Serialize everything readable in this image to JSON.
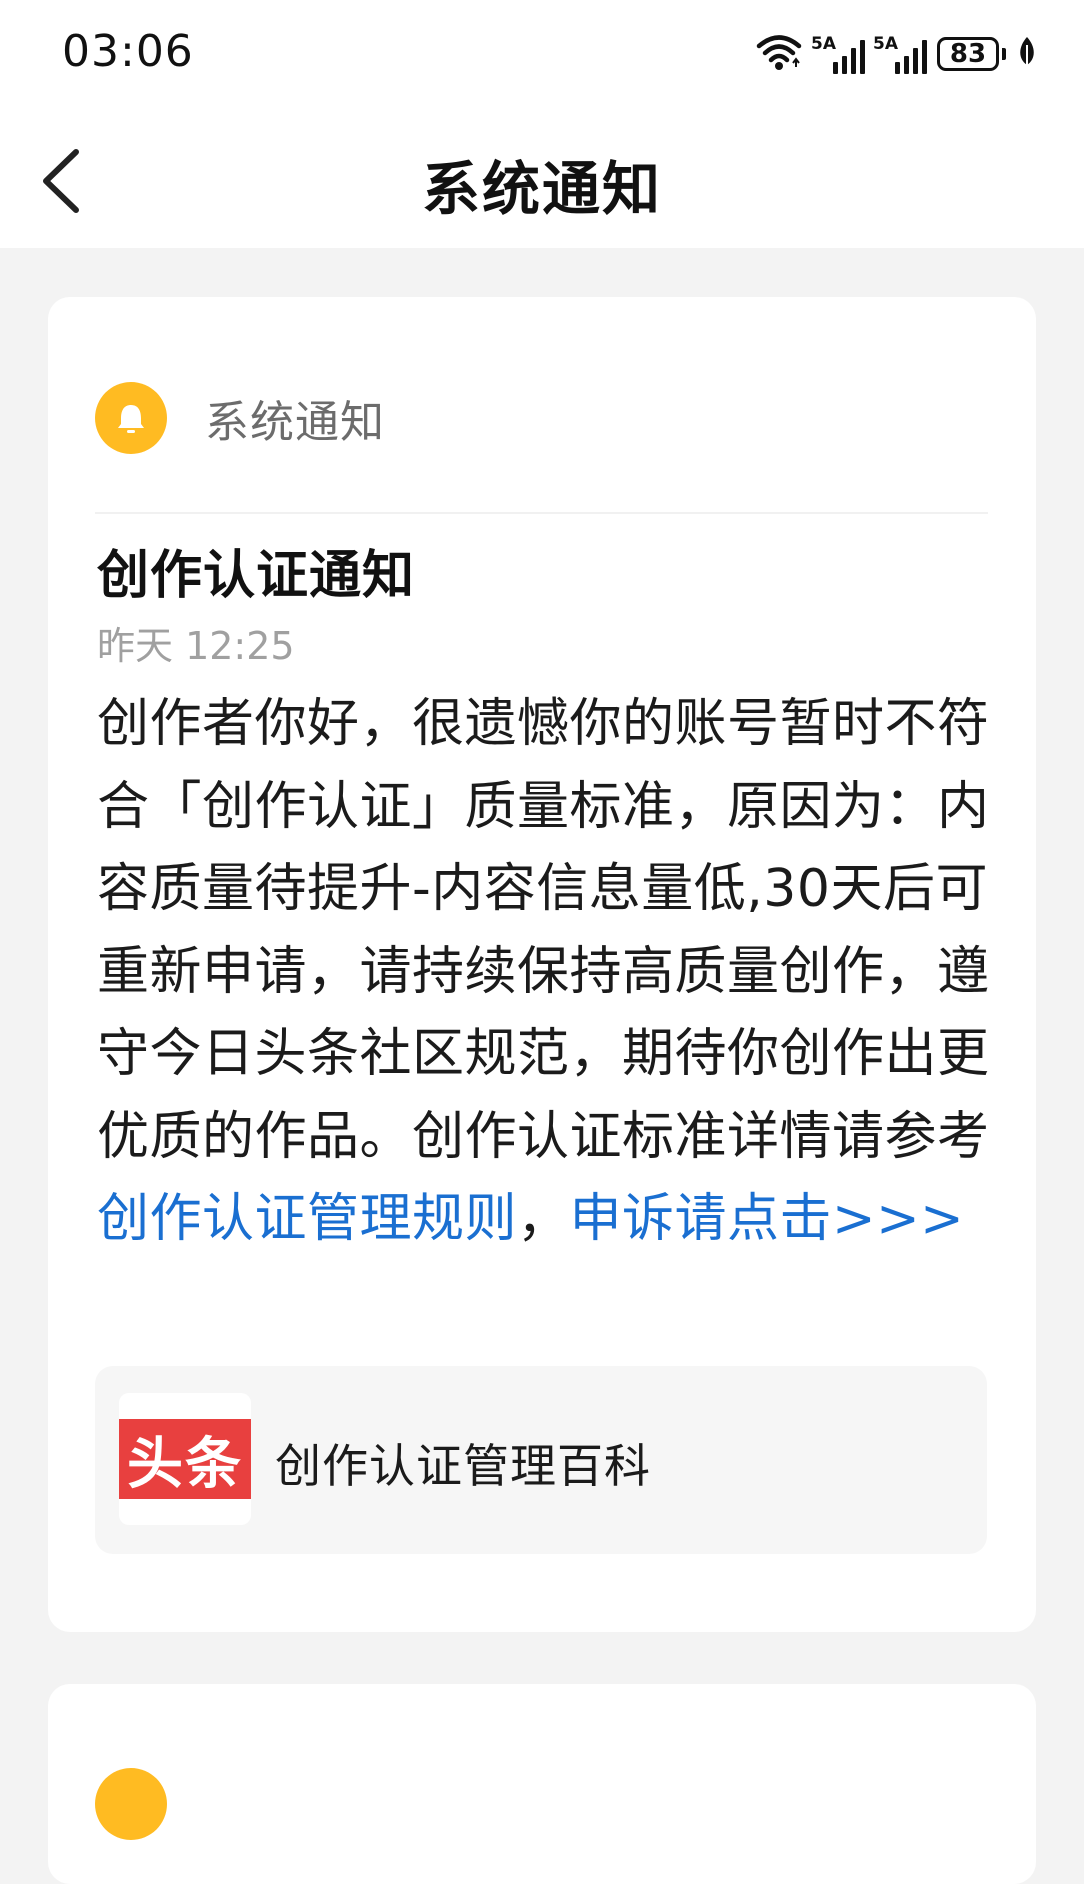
{
  "status_bar": {
    "time": "03:06",
    "signal_1_label": "5A",
    "signal_2_label": "5A",
    "battery_level": "83",
    "icons": [
      "wifi-icon",
      "signal-icon",
      "signal-icon",
      "battery-icon",
      "leaf-icon"
    ]
  },
  "nav": {
    "title": "系统通知",
    "back_icon": "chevron-left-icon"
  },
  "notice": {
    "source": "系统通知",
    "source_icon": "bell-icon",
    "title": "创作认证通知",
    "time": "昨天 12:25",
    "body_text": "创作者你好，很遗憾你的账号暂时不符合「创作认证」质量标准，原因为：内容质量待提升-内容信息量低,30天后可重新申请，请持续保持高质量创作，遵守今日头条社区规范，期待你创作出更优质的作品。创作认证标准详情请参考",
    "link_rules": "创作认证管理规则",
    "separator": "，",
    "link_appeal": "申诉请点击>>>",
    "reference": {
      "logo_text": "头条",
      "title": "创作认证管理百科"
    }
  },
  "colors": {
    "background": "#f3f3f3",
    "card": "#ffffff",
    "bell": "#ffbb22",
    "link": "#1a6fd1",
    "logo_red": "#e8403f",
    "muted": "#a0a0a0"
  }
}
